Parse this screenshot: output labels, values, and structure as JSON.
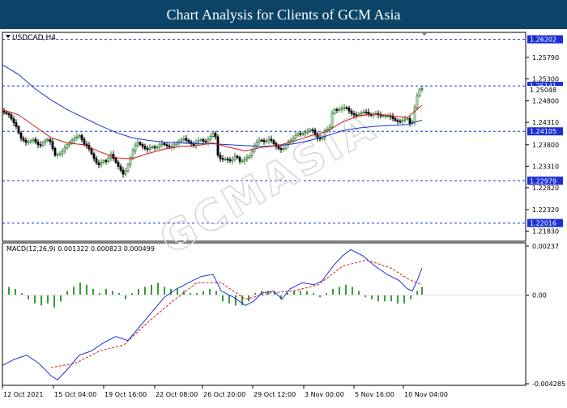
{
  "header": {
    "title": "Chart Analysis for Clients of GCM Asia"
  },
  "main_panel": {
    "symbol_label": "USDCAD,H4",
    "price_ticks": [
      "1.25790",
      "1.25300",
      "1.24800",
      "1.24310",
      "1.23800",
      "1.23310",
      "1.22820",
      "1.22320",
      "1.21830"
    ],
    "level_labels": [
      "1.26202",
      "1.25141",
      "1.25048",
      "1.24105",
      "1.22979",
      "1.22016"
    ],
    "watermark": "GCMASIA"
  },
  "macd_panel": {
    "label": "MACD(12,26,9) 0.001322 0.000823 0.000499",
    "ticks": [
      "0.00237",
      "0.00",
      "-0.004285"
    ]
  },
  "time_axis": {
    "labels": [
      "12 Oct 2021",
      "15 Oct 04:00",
      "19 Oct 16:00",
      "22 Oct 08:00",
      "26 Oct 20:00",
      "29 Oct 12:00",
      "3 Nov 00:00",
      "5 Nov 16:00",
      "10 Nov 04:00"
    ]
  },
  "colors": {
    "banner": "#0b4466",
    "bull": "#2e7d32",
    "bear": "#000000",
    "ma_fast": "#d01818",
    "ma_slow": "#1a2fd6",
    "level_line": "#1a2fd6",
    "level_tag": "#1a2fd6",
    "macd_line": "#1a2fd6",
    "signal_line": "#d01818",
    "hist": "#3a9a3a"
  },
  "chart_data": {
    "type": "candlestick",
    "instrument": "USDCAD",
    "timeframe": "H4",
    "price_range": [
      1.216,
      1.2636
    ],
    "close_path": [
      [
        0,
        1.2456
      ],
      [
        8,
        1.2448
      ],
      [
        18,
        1.2418
      ],
      [
        22,
        1.2396
      ],
      [
        30,
        1.2384
      ],
      [
        38,
        1.2392
      ],
      [
        46,
        1.2376
      ],
      [
        52,
        1.239
      ],
      [
        58,
        1.2392
      ],
      [
        65,
        1.2356
      ],
      [
        72,
        1.236
      ],
      [
        80,
        1.238
      ],
      [
        88,
        1.2394
      ],
      [
        96,
        1.2402
      ],
      [
        100,
        1.2382
      ],
      [
        105,
        1.2378
      ],
      [
        112,
        1.2352
      ],
      [
        118,
        1.2332
      ],
      [
        124,
        1.2344
      ],
      [
        128,
        1.2342
      ],
      [
        134,
        1.2358
      ],
      [
        140,
        1.234
      ],
      [
        146,
        1.2322
      ],
      [
        150,
        1.231
      ],
      [
        154,
        1.233
      ],
      [
        158,
        1.235
      ],
      [
        162,
        1.2372
      ],
      [
        166,
        1.2386
      ],
      [
        172,
        1.2378
      ],
      [
        178,
        1.2368
      ],
      [
        184,
        1.2376
      ],
      [
        190,
        1.2372
      ],
      [
        196,
        1.2384
      ],
      [
        202,
        1.2378
      ],
      [
        208,
        1.2374
      ],
      [
        212,
        1.238
      ],
      [
        218,
        1.2388
      ],
      [
        224,
        1.2394
      ],
      [
        230,
        1.2386
      ],
      [
        236,
        1.2378
      ],
      [
        240,
        1.2388
      ],
      [
        246,
        1.2392
      ],
      [
        250,
        1.2384
      ],
      [
        256,
        1.2396
      ],
      [
        262,
        1.2412
      ],
      [
        266,
        1.2356
      ],
      [
        270,
        1.2346
      ],
      [
        276,
        1.2348
      ],
      [
        282,
        1.2342
      ],
      [
        288,
        1.2356
      ],
      [
        294,
        1.234
      ],
      [
        300,
        1.2348
      ],
      [
        306,
        1.2356
      ],
      [
        312,
        1.2382
      ],
      [
        318,
        1.2392
      ],
      [
        324,
        1.2386
      ],
      [
        330,
        1.2394
      ],
      [
        336,
        1.238
      ],
      [
        340,
        1.2372
      ],
      [
        346,
        1.2368
      ],
      [
        352,
        1.2386
      ],
      [
        358,
        1.2392
      ],
      [
        364,
        1.2406
      ],
      [
        370,
        1.2404
      ],
      [
        376,
        1.241
      ],
      [
        382,
        1.2416
      ],
      [
        388,
        1.2396
      ],
      [
        394,
        1.2392
      ],
      [
        398,
        1.2412
      ],
      [
        404,
        1.242
      ],
      [
        408,
        1.2462
      ],
      [
        412,
        1.2458
      ],
      [
        418,
        1.2462
      ],
      [
        424,
        1.2466
      ],
      [
        430,
        1.2452
      ],
      [
        436,
        1.2446
      ],
      [
        442,
        1.2452
      ],
      [
        448,
        1.2456
      ],
      [
        454,
        1.2446
      ],
      [
        460,
        1.2452
      ],
      [
        466,
        1.2446
      ],
      [
        472,
        1.2446
      ],
      [
        478,
        1.2446
      ],
      [
        484,
        1.2436
      ],
      [
        490,
        1.2432
      ],
      [
        496,
        1.2438
      ],
      [
        500,
        1.244
      ],
      [
        505,
        1.242
      ],
      [
        510,
        1.2476
      ],
      [
        514,
        1.2506
      ],
      [
        518,
        1.2508
      ]
    ],
    "ma_fast": [
      [
        0,
        1.246
      ],
      [
        20,
        1.2448
      ],
      [
        40,
        1.2422
      ],
      [
        60,
        1.2396
      ],
      [
        80,
        1.2384
      ],
      [
        100,
        1.238
      ],
      [
        120,
        1.2364
      ],
      [
        140,
        1.235
      ],
      [
        160,
        1.2348
      ],
      [
        180,
        1.236
      ],
      [
        200,
        1.237
      ],
      [
        220,
        1.2376
      ],
      [
        240,
        1.2378
      ],
      [
        260,
        1.2384
      ],
      [
        280,
        1.2374
      ],
      [
        300,
        1.2366
      ],
      [
        320,
        1.2374
      ],
      [
        340,
        1.2378
      ],
      [
        360,
        1.2388
      ],
      [
        380,
        1.24
      ],
      [
        400,
        1.241
      ],
      [
        420,
        1.2432
      ],
      [
        440,
        1.2446
      ],
      [
        460,
        1.245
      ],
      [
        480,
        1.2446
      ],
      [
        500,
        1.2442
      ],
      [
        518,
        1.247
      ]
    ],
    "ma_slow": [
      [
        0,
        1.2562
      ],
      [
        20,
        1.254
      ],
      [
        40,
        1.2508
      ],
      [
        60,
        1.2482
      ],
      [
        80,
        1.246
      ],
      [
        100,
        1.2442
      ],
      [
        120,
        1.2424
      ],
      [
        140,
        1.2408
      ],
      [
        160,
        1.2396
      ],
      [
        180,
        1.239
      ],
      [
        200,
        1.2386
      ],
      [
        220,
        1.2384
      ],
      [
        240,
        1.2382
      ],
      [
        260,
        1.2382
      ],
      [
        280,
        1.238
      ],
      [
        300,
        1.2378
      ],
      [
        320,
        1.2376
      ],
      [
        340,
        1.2378
      ],
      [
        360,
        1.2382
      ],
      [
        380,
        1.239
      ],
      [
        400,
        1.24
      ],
      [
        420,
        1.2412
      ],
      [
        440,
        1.2418
      ],
      [
        460,
        1.2422
      ],
      [
        480,
        1.2424
      ],
      [
        500,
        1.2426
      ],
      [
        518,
        1.2436
      ]
    ],
    "levels": [
      1.26202,
      1.25141,
      1.24105,
      1.22979,
      1.22016
    ],
    "macd": {
      "range": [
        -0.004285,
        0.00237
      ],
      "macd_line": [
        [
          0,
          -0.0034
        ],
        [
          15,
          -0.0031
        ],
        [
          30,
          -0.0029
        ],
        [
          45,
          -0.0033
        ],
        [
          60,
          -0.0039
        ],
        [
          68,
          -0.0041
        ],
        [
          80,
          -0.0036
        ],
        [
          95,
          -0.0029
        ],
        [
          110,
          -0.0027
        ],
        [
          125,
          -0.0023
        ],
        [
          140,
          -0.002
        ],
        [
          155,
          -0.0022
        ],
        [
          170,
          -0.0015
        ],
        [
          185,
          -0.0008
        ],
        [
          200,
          -0.0001
        ],
        [
          215,
          0.0003
        ],
        [
          230,
          0.0006
        ],
        [
          245,
          0.0009
        ],
        [
          260,
          0.001
        ],
        [
          270,
          0.0002
        ],
        [
          285,
          -0.0001
        ],
        [
          300,
          -0.0005
        ],
        [
          310,
          -0.0003
        ],
        [
          320,
          0.0001
        ],
        [
          335,
          0.0002
        ],
        [
          345,
          -0.0002
        ],
        [
          355,
          0.0003
        ],
        [
          370,
          0.0006
        ],
        [
          385,
          0.0005
        ],
        [
          395,
          0.0007
        ],
        [
          408,
          0.0014
        ],
        [
          420,
          0.0019
        ],
        [
          430,
          0.0022
        ],
        [
          445,
          0.0019
        ],
        [
          460,
          0.0014
        ],
        [
          475,
          0.001
        ],
        [
          490,
          0.0007
        ],
        [
          500,
          0.0003
        ],
        [
          506,
          0.0002
        ],
        [
          512,
          0.0007
        ],
        [
          518,
          0.0013
        ]
      ],
      "signal_line": [
        [
          60,
          -0.0035
        ],
        [
          90,
          -0.0033
        ],
        [
          120,
          -0.0027
        ],
        [
          150,
          -0.0024
        ],
        [
          180,
          -0.0013
        ],
        [
          210,
          -0.0003
        ],
        [
          240,
          0.0006
        ],
        [
          270,
          0.0006
        ],
        [
          300,
          -0.0002
        ],
        [
          330,
          0.0001
        ],
        [
          360,
          0.0002
        ],
        [
          390,
          0.0005
        ],
        [
          420,
          0.0014
        ],
        [
          450,
          0.0017
        ],
        [
          480,
          0.0013
        ],
        [
          500,
          0.0008
        ],
        [
          518,
          0.0005
        ]
      ],
      "histogram": [
        [
          0,
          0.0002
        ],
        [
          8,
          0.0004
        ],
        [
          16,
          0.0003
        ],
        [
          24,
          0.0001
        ],
        [
          32,
          -0.0002
        ],
        [
          40,
          -0.0004
        ],
        [
          48,
          -0.0005
        ],
        [
          56,
          -0.0004
        ],
        [
          64,
          -0.0006
        ],
        [
          72,
          -0.0003
        ],
        [
          80,
          0.0002
        ],
        [
          88,
          0.0004
        ],
        [
          96,
          0.0006
        ],
        [
          104,
          0.0005
        ],
        [
          112,
          0.0003
        ],
        [
          120,
          0.0001
        ],
        [
          128,
          0.0003
        ],
        [
          136,
          0.0002
        ],
        [
          144,
          0.0001
        ],
        [
          152,
          -0.0002
        ],
        [
          160,
          0.0001
        ],
        [
          168,
          0.0003
        ],
        [
          176,
          0.0004
        ],
        [
          184,
          0.0005
        ],
        [
          192,
          0.0006
        ],
        [
          200,
          0.0004
        ],
        [
          208,
          0.0003
        ],
        [
          216,
          0.0003
        ],
        [
          224,
          0.0002
        ],
        [
          232,
          0.0001
        ],
        [
          240,
          0.0001
        ],
        [
          248,
          0.0002
        ],
        [
          256,
          0.0003
        ],
        [
          264,
          0.0002
        ],
        [
          272,
          -0.0003
        ],
        [
          280,
          -0.0004
        ],
        [
          288,
          -0.0005
        ],
        [
          296,
          -0.0005
        ],
        [
          304,
          -0.0003
        ],
        [
          312,
          0.0001
        ],
        [
          320,
          0.0002
        ],
        [
          328,
          0.0002
        ],
        [
          336,
          0.0001
        ],
        [
          344,
          -0.0002
        ],
        [
          352,
          0.0001
        ],
        [
          360,
          0.0002
        ],
        [
          368,
          0.0002
        ],
        [
          376,
          0.0002
        ],
        [
          384,
          0.0001
        ],
        [
          392,
          -0.0001
        ],
        [
          400,
          0.0001
        ],
        [
          408,
          0.0003
        ],
        [
          416,
          0.0004
        ],
        [
          424,
          0.0005
        ],
        [
          432,
          0.0004
        ],
        [
          440,
          0.0002
        ],
        [
          448,
          -0.0001
        ],
        [
          456,
          -0.0002
        ],
        [
          464,
          -0.0003
        ],
        [
          472,
          -0.0003
        ],
        [
          480,
          -0.0003
        ],
        [
          488,
          -0.0004
        ],
        [
          496,
          -0.0004
        ],
        [
          504,
          -0.0002
        ],
        [
          512,
          0.0002
        ],
        [
          518,
          0.0004
        ]
      ]
    }
  }
}
